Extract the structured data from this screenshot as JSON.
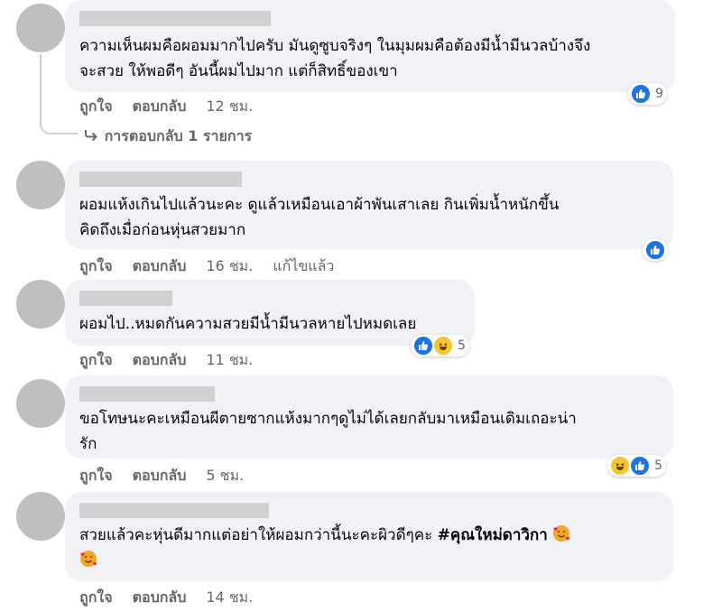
{
  "comments": [
    {
      "lines": [
        "ความเห็นผมคือผอมมากไปครับ มันดูซูบจริงๆ ในมุมผมคือต้องมีน้ำมีนวลบ้างจึง",
        "จะสวย ให้พอดีๆ อันนี้ผมไปมาก แต่ก็สิทธิ์ของเขา"
      ],
      "like": "ถูกใจ",
      "reply": "ตอบกลับ",
      "time": "12 ชม.",
      "reaction_count": "9",
      "view_replies": "การตอบกลับ 1 รายการ"
    },
    {
      "lines": [
        "ผอมแห้งเกินไปแล้วนะคะ ดูแล้วเหมือนเอาผ้าพันเสาเลย กินเพิ่มน้ำหนักขึ้น",
        "คิดถึงเมื่อก่อนหุ่นสวยมาก"
      ],
      "like": "ถูกใจ",
      "reply": "ตอบกลับ",
      "time": "16 ชม.",
      "edited": "แก้ไขแล้ว"
    },
    {
      "lines": [
        "ผอมไป..หมดกันความสวยมีน้ำมีนวลหายไปหมดเลย"
      ],
      "like": "ถูกใจ",
      "reply": "ตอบกลับ",
      "time": "11 ชม.",
      "reaction_count": "5"
    },
    {
      "lines": [
        "ขอโทษนะคะเหมือนผีตายซากแห้งมากๆดูไม่ได้เลยกลับมาเหมือนเดิมเถอะน่า",
        "รัก"
      ],
      "like": "ถูกใจ",
      "reply": "ตอบกลับ",
      "time": "5 ชม.",
      "reaction_count": "5"
    },
    {
      "line1": "สวยแล้วคะหุ่นดีมากแต่อย่าให้ผอมกว่านี้นะคะผิวดีๆคะ ",
      "hashtag": "#คุณใหม่ดาวิกา",
      "like": "ถูกใจ",
      "reply": "ตอบกลับ",
      "time": "14 ชม."
    }
  ],
  "icons": {
    "like_color": "#1b74e4",
    "haha_color": "#f7c62f",
    "emoji_color": "#f5a623",
    "reply_arrow": "reply-arrow-icon"
  }
}
